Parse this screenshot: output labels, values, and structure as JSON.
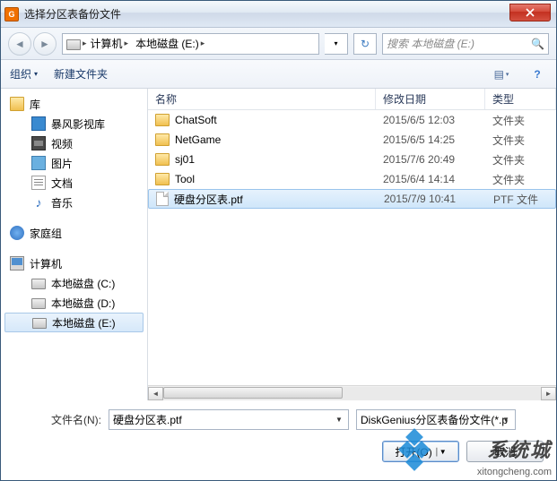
{
  "window": {
    "title": "选择分区表备份文件"
  },
  "nav": {
    "refresh_tip": "刷新",
    "breadcrumb": [
      "计算机",
      "本地磁盘 (E:)"
    ]
  },
  "search": {
    "placeholder": "搜索 本地磁盘 (E:)"
  },
  "toolbar": {
    "organize": "组织",
    "new_folder": "新建文件夹"
  },
  "columns": {
    "name": "名称",
    "modified": "修改日期",
    "type": "类型"
  },
  "tree": {
    "libraries": "库",
    "lib_items": [
      "暴风影视库",
      "视频",
      "图片",
      "文档",
      "音乐"
    ],
    "homegroup": "家庭组",
    "computer": "计算机",
    "drives": [
      "本地磁盘 (C:)",
      "本地磁盘 (D:)",
      "本地磁盘 (E:)"
    ]
  },
  "files": [
    {
      "name": "ChatSoft",
      "date": "2015/6/5 12:03",
      "type": "文件夹",
      "kind": "folder"
    },
    {
      "name": "NetGame",
      "date": "2015/6/5 14:25",
      "type": "文件夹",
      "kind": "folder"
    },
    {
      "name": "sj01",
      "date": "2015/7/6 20:49",
      "type": "文件夹",
      "kind": "folder"
    },
    {
      "name": "Tool",
      "date": "2015/6/4 14:14",
      "type": "文件夹",
      "kind": "folder"
    },
    {
      "name": "硬盘分区表.ptf",
      "date": "2015/7/9 10:41",
      "type": "PTF 文件",
      "kind": "file",
      "selected": true
    }
  ],
  "form": {
    "filename_label": "文件名(N):",
    "filename_value": "硬盘分区表.ptf",
    "filter_value": "DiskGenius分区表备份文件(*.p",
    "open_label": "打开(O)",
    "cancel_label": "取消"
  },
  "watermark": {
    "text": "系统城",
    "url": "xitongcheng.com"
  }
}
